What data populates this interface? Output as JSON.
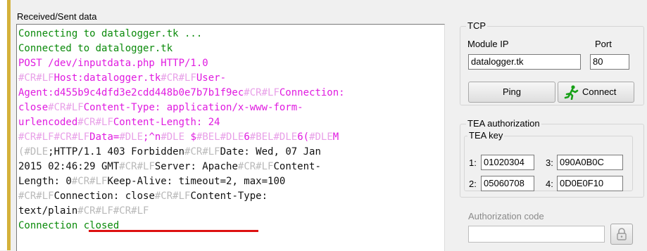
{
  "log": {
    "title": "Received/Sent data",
    "lines": [
      [
        {
          "t": "Connecting to datalogger.tk ...",
          "c": "green"
        }
      ],
      [
        {
          "t": "Connected to datalogger.tk",
          "c": "green"
        }
      ],
      [
        {
          "t": "POST /dev/inputdata.php HTTP/1.0",
          "c": "pink"
        }
      ],
      [
        {
          "t": "#CR#LF",
          "c": "tok2"
        },
        {
          "t": "Host:datalogger.tk",
          "c": "pink"
        },
        {
          "t": "#CR#LF",
          "c": "tok2"
        },
        {
          "t": "User-",
          "c": "pink"
        }
      ],
      [
        {
          "t": "Agent:d455b9c4dfd3e2cdd448b0e7b7b1f9ec",
          "c": "pink"
        },
        {
          "t": "#CR#LF",
          "c": "tok2"
        },
        {
          "t": "Connection:",
          "c": "pink"
        }
      ],
      [
        {
          "t": "close",
          "c": "pink"
        },
        {
          "t": "#CR#LF",
          "c": "tok2"
        },
        {
          "t": "Content-Type: application/x-www-form-",
          "c": "pink"
        }
      ],
      [
        {
          "t": "urlencoded",
          "c": "pink"
        },
        {
          "t": "#CR#LF",
          "c": "tok2"
        },
        {
          "t": "Content-Length: 24",
          "c": "pink"
        }
      ],
      [
        {
          "t": "#CR#LF#CR#LF",
          "c": "tok2"
        },
        {
          "t": "Data=",
          "c": "pink"
        },
        {
          "t": "#DLE",
          "c": "tok2"
        },
        {
          "t": ";^n",
          "c": "pink"
        },
        {
          "t": "#DLE",
          "c": "tok2"
        },
        {
          "t": " $",
          "c": "pink"
        },
        {
          "t": "#BEL#DLE",
          "c": "tok2"
        },
        {
          "t": "6",
          "c": "pink"
        },
        {
          "t": "#BEL#DLE",
          "c": "tok2"
        },
        {
          "t": "6(",
          "c": "pink"
        },
        {
          "t": "#DLE",
          "c": "tok2"
        },
        {
          "t": "M",
          "c": "pink"
        }
      ],
      [
        {
          "t": "(",
          "c": "tok"
        },
        {
          "t": "#DLE",
          "c": "tok"
        },
        {
          "t": ";HTTP/1.1 403 Forbidden",
          "c": "black"
        },
        {
          "t": "#CR#LF",
          "c": "tok"
        },
        {
          "t": "Date: Wed, 07 Jan",
          "c": "black"
        }
      ],
      [
        {
          "t": "2015 02:46:29 GMT",
          "c": "black"
        },
        {
          "t": "#CR#LF",
          "c": "tok"
        },
        {
          "t": "Server: Apache",
          "c": "black"
        },
        {
          "t": "#CR#LF",
          "c": "tok"
        },
        {
          "t": "Content-",
          "c": "black"
        }
      ],
      [
        {
          "t": "Length: 0",
          "c": "black"
        },
        {
          "t": "#CR#LF",
          "c": "tok"
        },
        {
          "t": "Keep-Alive: timeout=2, max=100",
          "c": "black"
        }
      ],
      [
        {
          "t": "#CR#LF",
          "c": "tok"
        },
        {
          "t": "Connection: close",
          "c": "black"
        },
        {
          "t": "#CR#LF",
          "c": "tok"
        },
        {
          "t": "Content-Type:",
          "c": "black"
        }
      ],
      [
        {
          "t": "text/plain",
          "c": "black"
        },
        {
          "t": "#CR#LF#CR#LF",
          "c": "tok"
        }
      ],
      [
        {
          "t": "Connection closed",
          "c": "green"
        }
      ]
    ]
  },
  "tcp": {
    "legend": "TCP",
    "module_ip_label": "Module IP",
    "module_ip_value": "datalogger.tk",
    "port_label": "Port",
    "port_value": "80",
    "ping_label": "Ping",
    "connect_label": "Connect"
  },
  "tea": {
    "legend": "TEA authorization",
    "key_legend": "TEA key",
    "keys": [
      {
        "n": "1:",
        "v": "01020304"
      },
      {
        "n": "3:",
        "v": "090A0B0C"
      },
      {
        "n": "2:",
        "v": "05060708"
      },
      {
        "n": "4:",
        "v": "0D0E0F10"
      }
    ],
    "auth_label": "Authorization code",
    "auth_value": ""
  },
  "icons": {
    "connect": "running-man-icon",
    "lock": "padlock-icon"
  },
  "colors": {
    "green": "#0a8a0a",
    "pink": "#e01be0",
    "token": "#b9b9b9",
    "highlight": "#d11111"
  }
}
